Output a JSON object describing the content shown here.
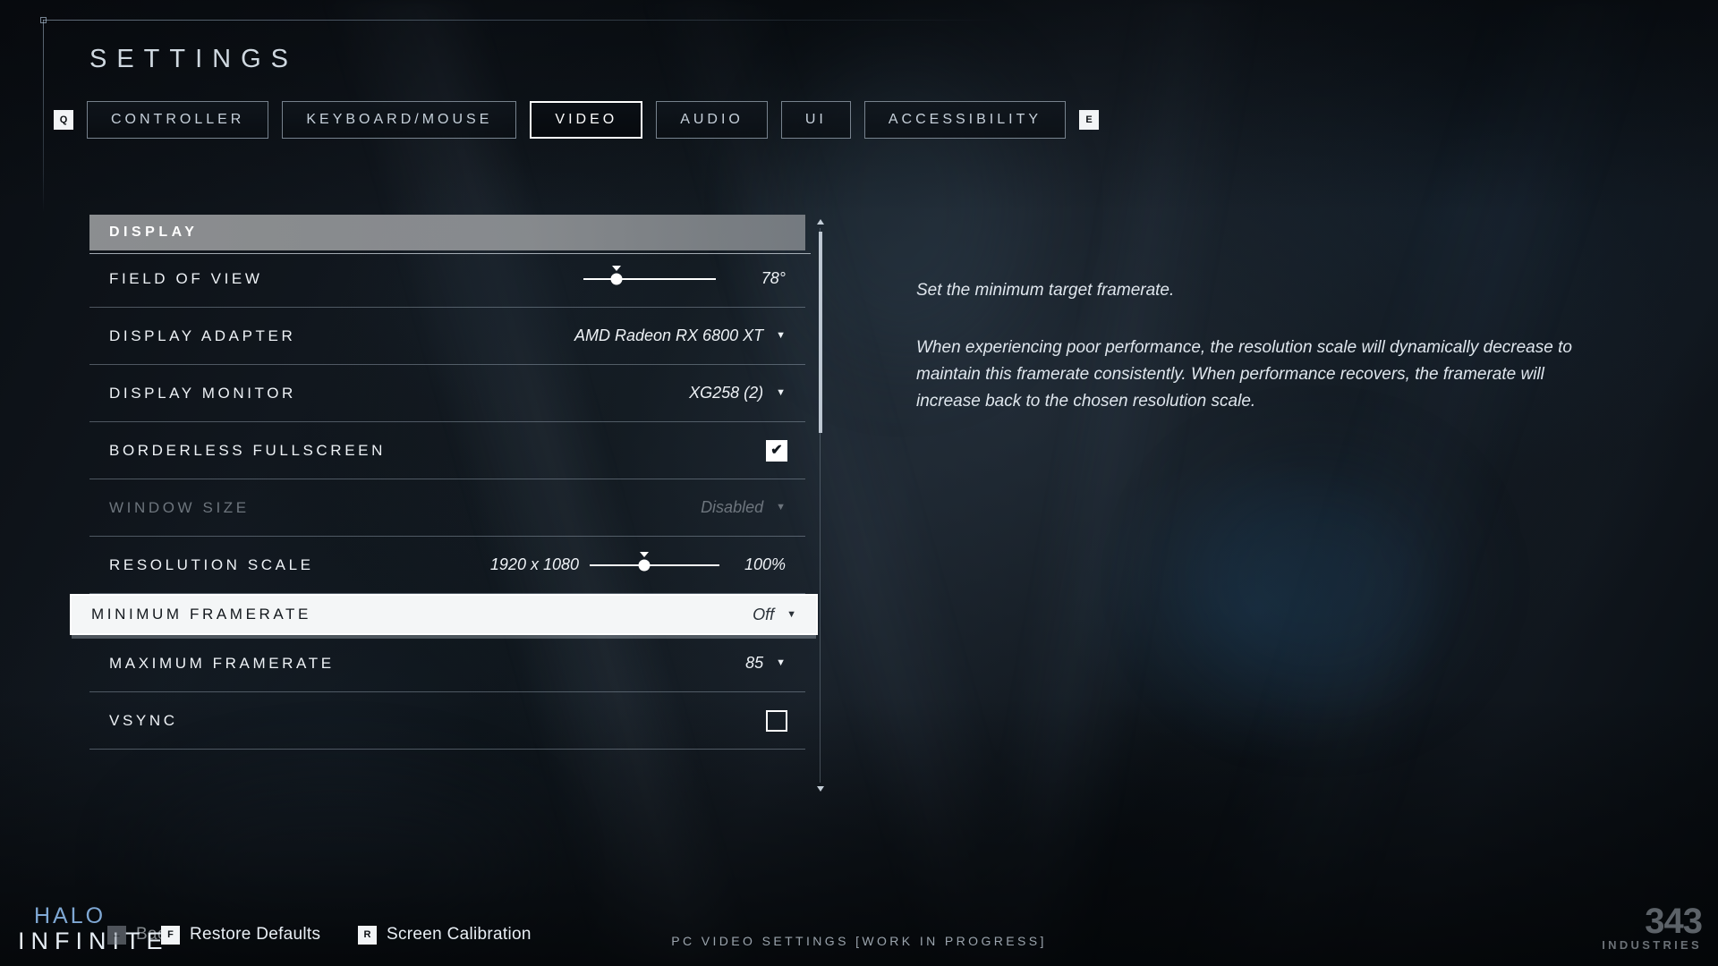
{
  "header": {
    "title": "SETTINGS",
    "left_key_hint": "Q",
    "right_key_hint": "E",
    "tabs": [
      {
        "label": "CONTROLLER",
        "active": false
      },
      {
        "label": "KEYBOARD/MOUSE",
        "active": false
      },
      {
        "label": "VIDEO",
        "active": true
      },
      {
        "label": "AUDIO",
        "active": false
      },
      {
        "label": "UI",
        "active": false
      },
      {
        "label": "ACCESSIBILITY",
        "active": false
      }
    ]
  },
  "panel": {
    "section_title": "DISPLAY",
    "rows": [
      {
        "label": "FIELD OF VIEW",
        "type": "slider",
        "value": "78°",
        "percent": 25
      },
      {
        "label": "DISPLAY ADAPTER",
        "type": "dropdown",
        "value": "AMD Radeon RX 6800 XT"
      },
      {
        "label": "DISPLAY MONITOR",
        "type": "dropdown",
        "value": "XG258 (2)"
      },
      {
        "label": "BORDERLESS FULLSCREEN",
        "type": "checkbox",
        "checked": true,
        "check_glyph": "✔"
      },
      {
        "label": "WINDOW SIZE",
        "type": "dropdown",
        "value": "Disabled",
        "disabled": true
      },
      {
        "label": "RESOLUTION SCALE",
        "type": "slider",
        "prefix": "1920 x 1080",
        "value": "100%",
        "percent": 42
      },
      {
        "label": "MINIMUM FRAMERATE",
        "type": "dropdown",
        "value": "Off",
        "selected": true
      },
      {
        "label": "MAXIMUM FRAMERATE",
        "type": "dropdown",
        "value": "85"
      },
      {
        "label": "VSYNC",
        "type": "checkbox",
        "checked": false,
        "check_glyph": "✔"
      }
    ]
  },
  "description": {
    "line1": "Set the minimum target framerate.",
    "line2": "When experiencing poor performance, the resolution scale will dynamically decrease to maintain this framerate consistently. When performance recovers, the framerate will increase back to the chosen resolution scale."
  },
  "footer": {
    "logo_top": "HALO",
    "logo_bottom": "INFINITE",
    "back": {
      "key": "←",
      "label": "Back"
    },
    "restore": {
      "key": "F",
      "label": "Restore Defaults"
    },
    "calibration": {
      "key": "R",
      "label": "Screen Calibration"
    },
    "center_note": "PC VIDEO SETTINGS [WORK IN PROGRESS]",
    "studio_number": "343",
    "studio_name": "INDUSTRIES"
  },
  "colors": {
    "accent_white": "#ffffff",
    "section_band": "#96989a",
    "selected_row_bg": "#f4f6f7",
    "halo_blue": "#7fa8d4",
    "disabled_text": "#6d757d"
  }
}
